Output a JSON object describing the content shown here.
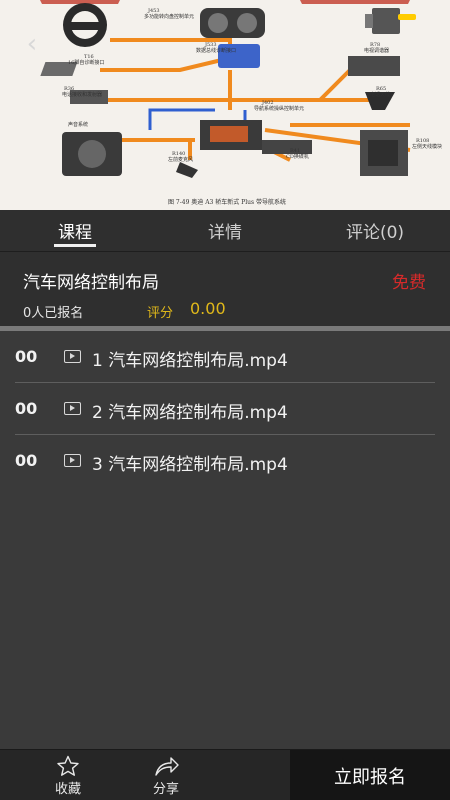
{
  "hero": {
    "caption": "图 7-49  奥迪 A3 轿车新式 Plus 带导航系统",
    "diagram_labels": {
      "j453": "J453",
      "j453_desc": "多功能转向盘控制单元",
      "j533": "J533",
      "j533_desc": "数据总线诊断接口",
      "t16": "T16",
      "t16_desc": "16脚自诊断接口",
      "r36": "R36",
      "r36_desc": "电话接收和发射器",
      "sound": "声音系统",
      "r140": "R140",
      "r140_desc": "左前麦克风",
      "j402": "J402",
      "j402_desc": "导航系统操纵控制单元",
      "r41": "R41",
      "r41_desc": "CD换碟机",
      "r65": "R65",
      "r65_desc": "电话天线",
      "r78": "R78",
      "r78_desc": "电视调谐器",
      "r108": "R108",
      "r108_desc": "左侧天线模块"
    }
  },
  "tabs": [
    "课程",
    "详情",
    "评论(0)"
  ],
  "course": {
    "title": "汽车网络控制布局",
    "price": "免费",
    "enrolled": "0人已报名",
    "score_label": "评分",
    "score_value": "0.00"
  },
  "lessons": [
    {
      "num": "00",
      "name": "1 汽车网络控制布局.mp4"
    },
    {
      "num": "00",
      "name": "2 汽车网络控制布局.mp4"
    },
    {
      "num": "00",
      "name": "3 汽车网络控制布局.mp4"
    }
  ],
  "bottom": {
    "favorite": "收藏",
    "share": "分享",
    "enroll": "立即报名"
  },
  "colors": {
    "price": "#d62a2a",
    "score": "#e0b81a",
    "wire_orange": "#f08a1e",
    "wire_blue": "#2f5fd0"
  }
}
